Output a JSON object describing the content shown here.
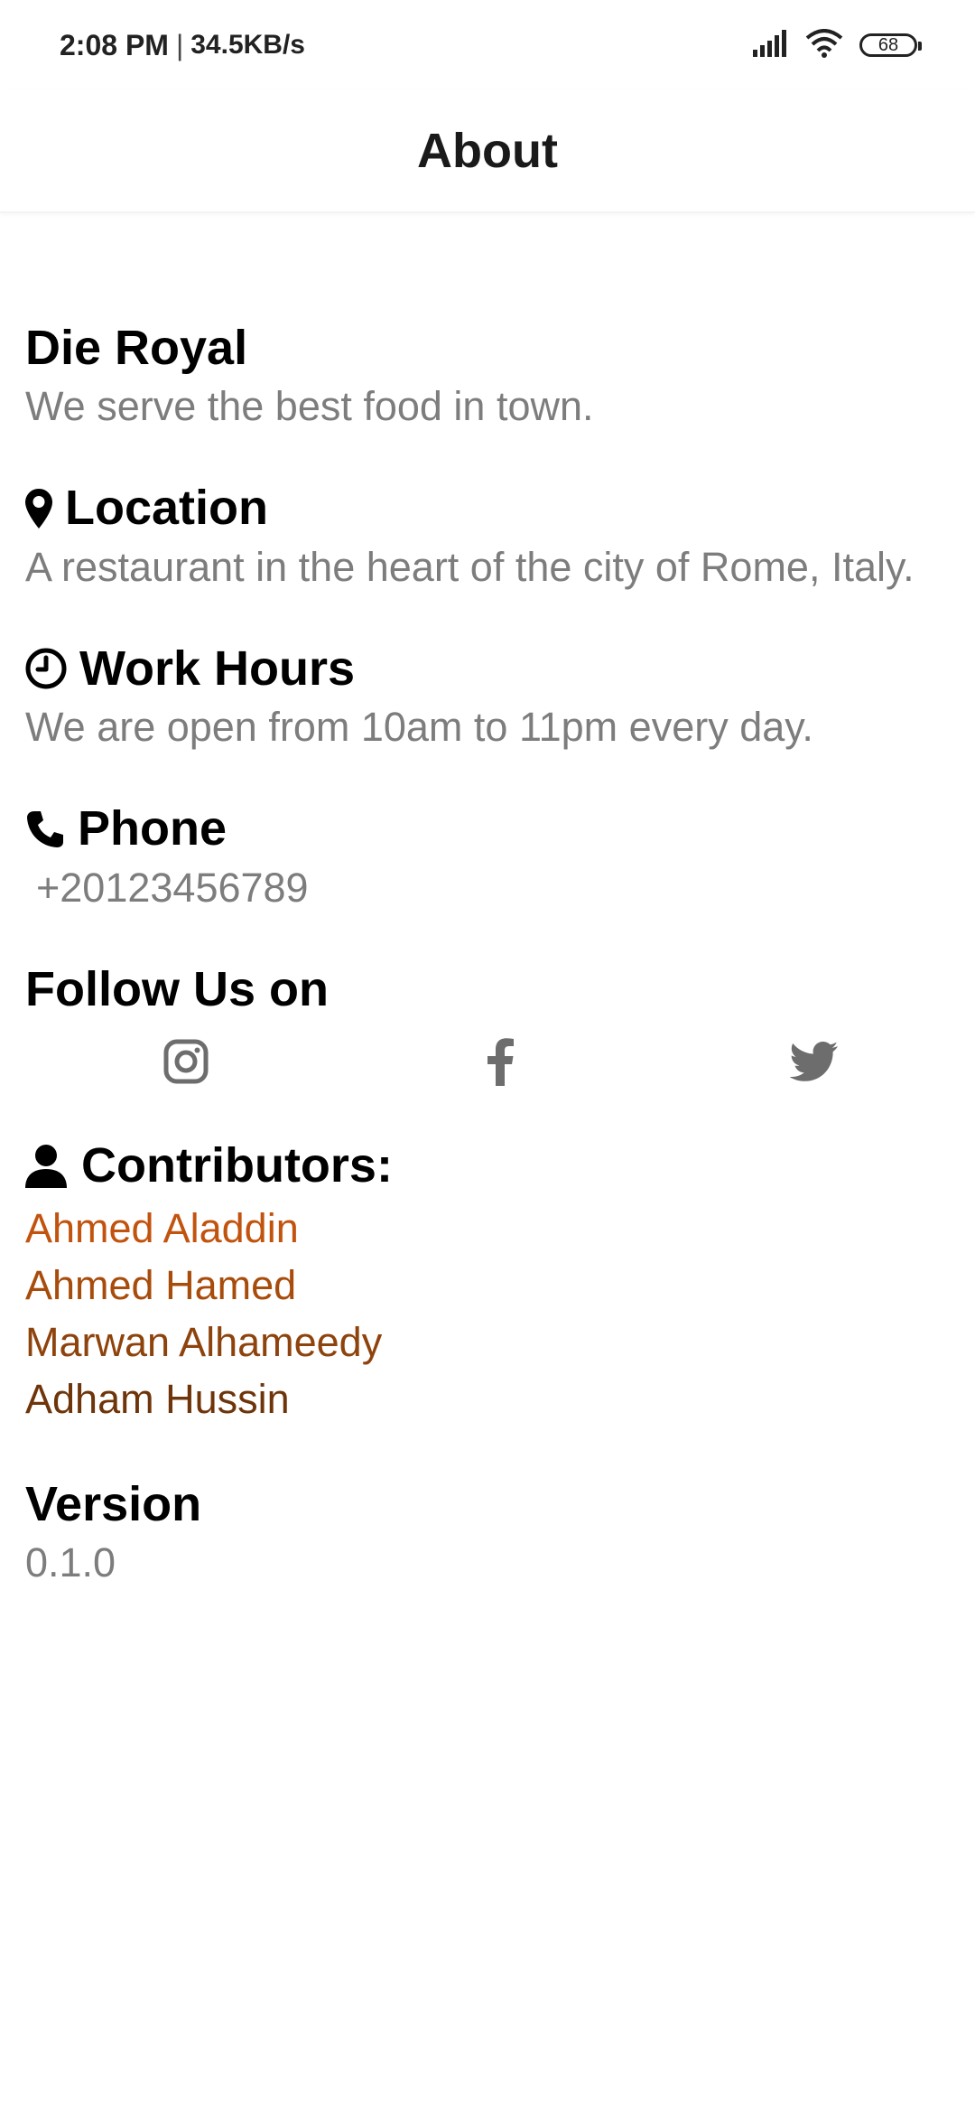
{
  "status_bar": {
    "time": "2:08 PM",
    "separator": "|",
    "speed": "34.5KB/s",
    "battery": "68",
    "icons": [
      "signal-icon",
      "wifi-icon",
      "battery-icon"
    ]
  },
  "app_bar": {
    "title": "About"
  },
  "restaurant": {
    "name": "Die Royal",
    "tagline": "We serve the best food in town."
  },
  "location": {
    "title": "Location",
    "text": "A restaurant in the heart of the city of Rome, Italy.",
    "icon": "map-pin-icon"
  },
  "work_hours": {
    "title": "Work Hours",
    "text": "We are open from 10am to 11pm every day.",
    "icon": "clock-icon"
  },
  "phone": {
    "title": "Phone",
    "text": "+20123456789",
    "icon": "phone-icon"
  },
  "follow": {
    "title": "Follow Us on",
    "icons": [
      "instagram-icon",
      "facebook-icon",
      "twitter-icon"
    ],
    "icon_color": "#6d6d6d"
  },
  "contributors": {
    "title": "Contributors:",
    "icon": "person-icon",
    "names": [
      {
        "name": "Ahmed Aladdin",
        "color": "#c2530e"
      },
      {
        "name": "Ahmed Hamed",
        "color": "#a84c0c"
      },
      {
        "name": "Marwan Alhameedy",
        "color": "#8e430c"
      },
      {
        "name": "Adham Hussin",
        "color": "#6f350a"
      }
    ]
  },
  "version": {
    "title": "Version",
    "text": "0.1.0"
  }
}
